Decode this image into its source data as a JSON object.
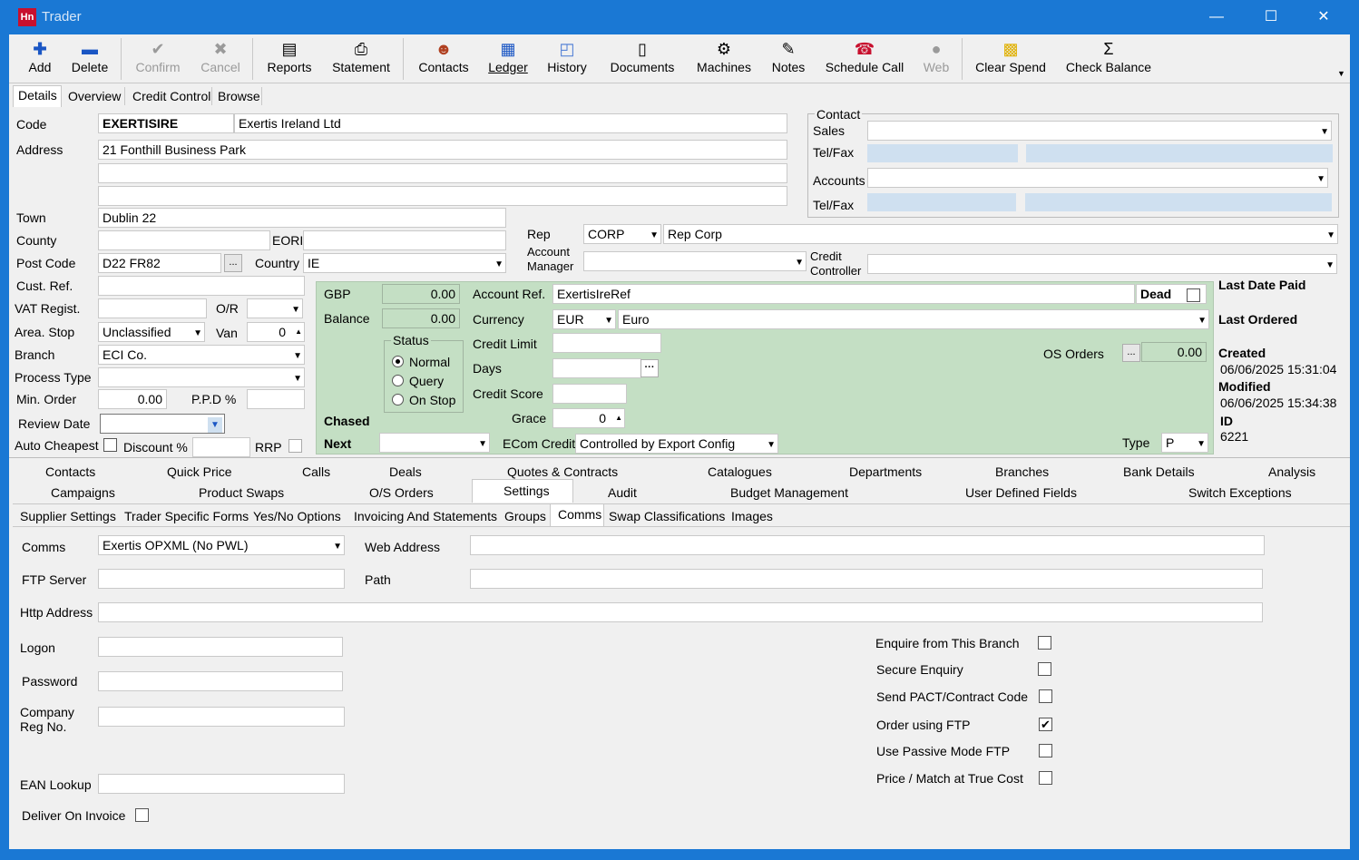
{
  "window": {
    "title": "Trader",
    "logo_text": "Hn",
    "min": "—",
    "max": "☐",
    "close": "✕"
  },
  "toolbar": {
    "add": "Add",
    "delete": "Delete",
    "confirm": "Confirm",
    "cancel": "Cancel",
    "reports": "Reports",
    "statement": "Statement",
    "contacts": "Contacts",
    "ledger": "Ledger",
    "history": "History",
    "documents": "Documents",
    "machines": "Machines",
    "notes": "Notes",
    "schedule_call": "Schedule Call",
    "web": "Web",
    "clear_spend": "Clear Spend",
    "check_balance": "Check Balance"
  },
  "top_tabs": [
    "Details",
    "Overview",
    "Credit Control",
    "Browse"
  ],
  "details": {
    "code_label": "Code",
    "code": "EXERTISIRE",
    "name": "Exertis Ireland Ltd",
    "address_label": "Address",
    "address1": "21 Fonthill Business Park",
    "address2": "",
    "address3": "",
    "town_label": "Town",
    "town": "Dublin 22",
    "county_label": "County",
    "county": "",
    "eori_label": "EORI",
    "eori": "",
    "postcode_label": "Post Code",
    "postcode": "D22 FR82",
    "country_label": "Country",
    "country": "IE",
    "custref_label": "Cust. Ref.",
    "custref": "",
    "vat_label": "VAT Regist.",
    "vat": "",
    "or_label": "O/R",
    "area_label": "Area. Stop",
    "area": "Unclassified",
    "van_label": "Van",
    "van": "0",
    "branch_label": "Branch",
    "branch": "ECI Co.",
    "process_label": "Process Type",
    "process": "",
    "minorder_label": "Min. Order",
    "minorder": "0.00",
    "ppd_label": "P.P.D %",
    "ppd": "",
    "review_label": "Review Date",
    "autocheapest_label": "Auto Cheapest",
    "discount_label": "Discount %",
    "rrp_label": "RRP"
  },
  "contact": {
    "group_label": "Contact",
    "sales_label": "Sales",
    "telfax_label": "Tel/Fax",
    "accounts_label": "Accounts",
    "telfax2_label": "Tel/Fax"
  },
  "rep": {
    "rep_label": "Rep",
    "rep_code": "CORP",
    "rep_name": "Rep Corp",
    "acct_mgr_label1": "Account",
    "acct_mgr_label2": "Manager",
    "credit_ctrl_label1": "Credit",
    "credit_ctrl_label2": "Controller"
  },
  "account": {
    "gbp_label": "GBP",
    "gbp": "0.00",
    "balance_label": "Balance",
    "balance": "0.00",
    "status_label": "Status",
    "status_options": [
      "Normal",
      "Query",
      "On Stop"
    ],
    "chased_label": "Chased",
    "next_label": "Next",
    "acctref_label": "Account Ref.",
    "acctref": "ExertisIreRef",
    "dead_label": "Dead",
    "currency_label": "Currency",
    "currency_code": "EUR",
    "currency_name": "Euro",
    "creditlimit_label": "Credit Limit",
    "days_label": "Days",
    "creditscore_label": "Credit Score",
    "grace_label": "Grace",
    "grace": "0",
    "ecom_label": "ECom Credit",
    "ecom": "Controlled by Export Config",
    "osorders_label": "OS Orders",
    "osorders": "0.00",
    "type_label": "Type",
    "type": "P"
  },
  "side": {
    "last_paid_label": "Last Date Paid",
    "last_ordered_label": "Last Ordered",
    "created_label": "Created",
    "created": "06/06/2025 15:31:04",
    "modified_label": "Modified",
    "modified": "06/06/2025 15:34:38",
    "id_label": "ID",
    "id": "6221"
  },
  "tabs_row1": [
    "Contacts",
    "Quick Price",
    "Calls",
    "Deals",
    "Quotes & Contracts",
    "Catalogues",
    "Departments",
    "Branches",
    "Bank Details",
    "Analysis"
  ],
  "tabs_row2": [
    "Campaigns",
    "Product Swaps",
    "O/S Orders",
    "Settings",
    "Audit",
    "Budget Management",
    "User Defined Fields",
    "Switch Exceptions"
  ],
  "tabs_row3": [
    "Supplier Settings",
    "Trader Specific Forms",
    "Yes/No Options",
    "Invoicing And Statements",
    "Groups",
    "Comms",
    "Swap Classifications",
    "Images"
  ],
  "comms": {
    "comms_label": "Comms",
    "comms": "Exertis OPXML (No PWL)",
    "web_label": "Web Address",
    "web": "",
    "ftp_label": "FTP Server",
    "ftp": "",
    "path_label": "Path",
    "path": "",
    "http_label": "Http Address",
    "http": "",
    "logon_label": "Logon",
    "password_label": "Password",
    "company_label1": "Company",
    "company_label2": "Reg No.",
    "ean_label": "EAN Lookup",
    "deliver_label": "Deliver On Invoice",
    "enquire_label": "Enquire from This Branch",
    "secure_label": "Secure Enquiry",
    "pact_label": "Send PACT/Contract Code",
    "orderftp_label": "Order using FTP",
    "passive_label": "Use Passive Mode FTP",
    "price_label": "Price / Match at True Cost",
    "order_ftp_checked": true
  }
}
